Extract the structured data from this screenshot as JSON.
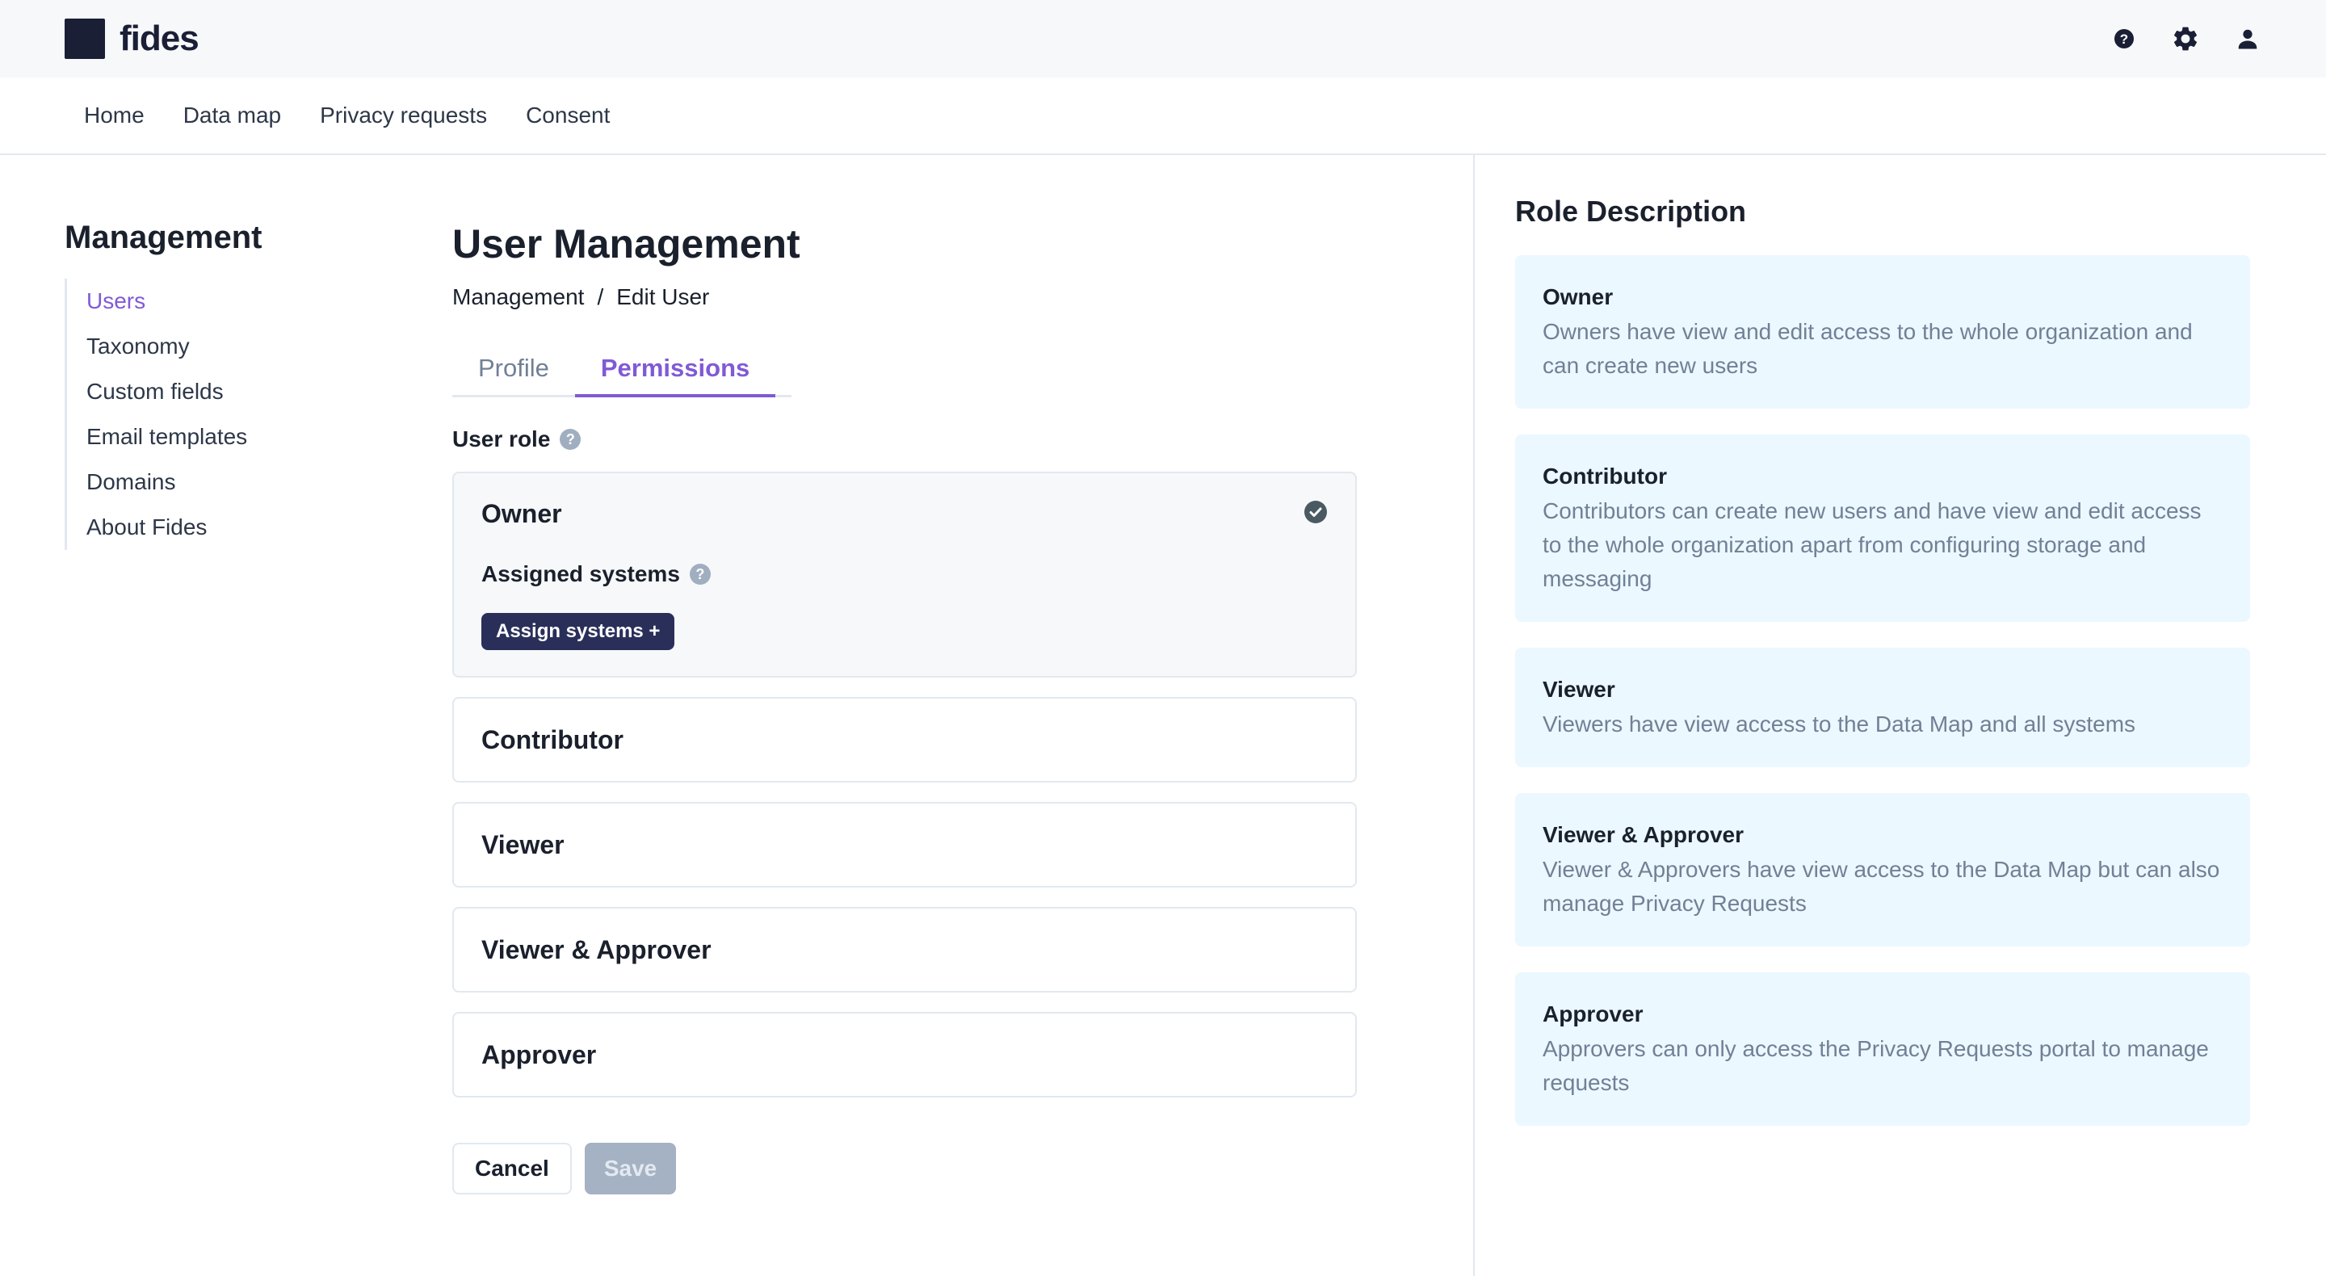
{
  "app": {
    "name": "fides"
  },
  "nav": {
    "items": [
      "Home",
      "Data map",
      "Privacy requests",
      "Consent"
    ]
  },
  "sidebar": {
    "title": "Management",
    "items": [
      "Users",
      "Taxonomy",
      "Custom fields",
      "Email templates",
      "Domains",
      "About Fides"
    ],
    "active": "Users"
  },
  "main": {
    "title": "User Management",
    "breadcrumb": [
      "Management",
      "/",
      "Edit User"
    ],
    "tabs": [
      "Profile",
      "Permissions"
    ],
    "active_tab": "Permissions",
    "user_role_label": "User role",
    "roles": [
      "Owner",
      "Contributor",
      "Viewer",
      "Viewer & Approver",
      "Approver"
    ],
    "selected_role": "Owner",
    "assigned_systems_label": "Assigned systems",
    "assign_button": "Assign systems +",
    "cancel_label": "Cancel",
    "save_label": "Save"
  },
  "role_description": {
    "title": "Role Description",
    "items": [
      {
        "name": "Owner",
        "text": "Owners have view and edit access to the whole organization and can create new users"
      },
      {
        "name": "Contributor",
        "text": "Contributors can create new users and have view and edit access to the whole organization apart from configuring storage and messaging"
      },
      {
        "name": "Viewer",
        "text": "Viewers have view access to the Data Map and all systems"
      },
      {
        "name": "Viewer & Approver",
        "text": "Viewer & Approvers have view access to the Data Map but can also manage Privacy Requests"
      },
      {
        "name": "Approver",
        "text": "Approvers can only access the Privacy Requests portal to manage requests"
      }
    ]
  },
  "icons": {
    "help": "?",
    "settings": "gear-icon",
    "user": "user-icon",
    "check": "check-circle-icon"
  },
  "colors": {
    "accent": "#805ad5",
    "brand_dark": "#1a1f36",
    "assign_button": "#2a2f5a",
    "description_bg": "#ebf8ff"
  }
}
